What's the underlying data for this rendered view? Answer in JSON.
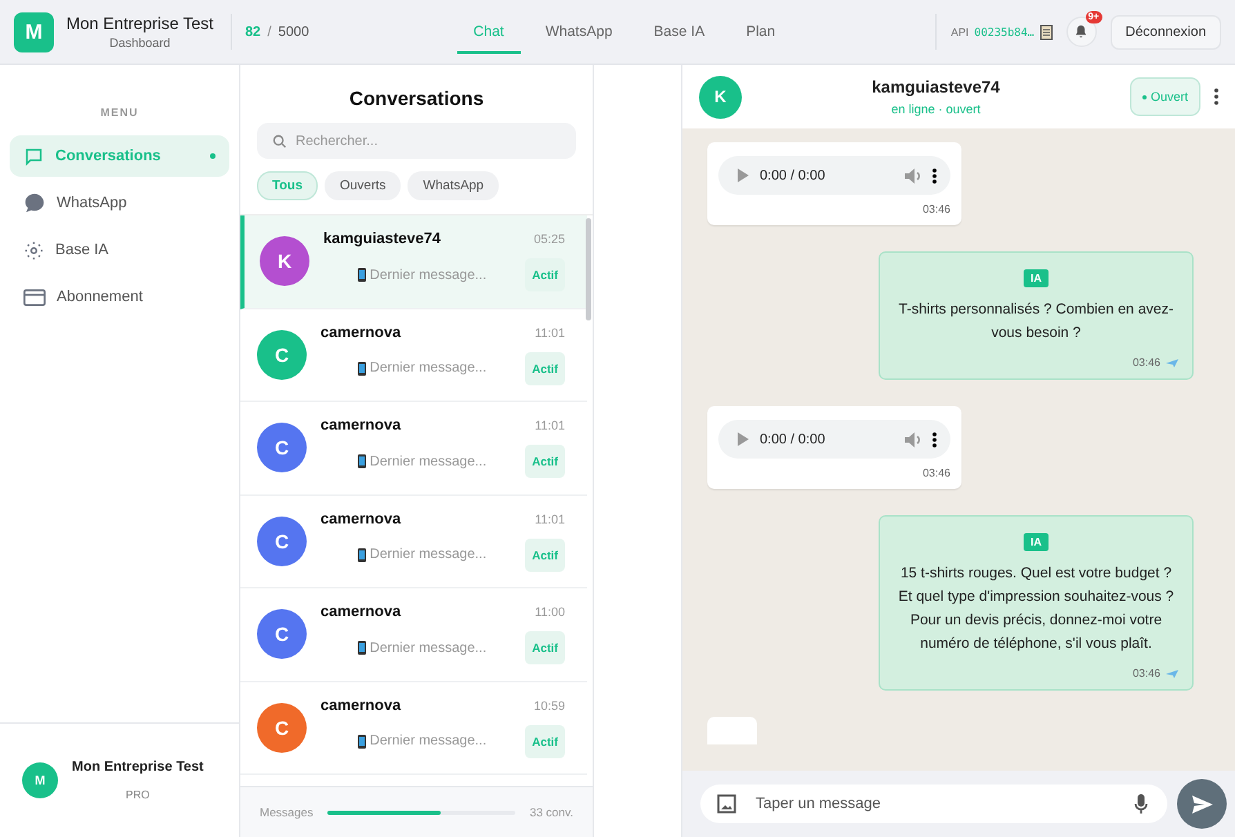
{
  "header": {
    "logo_letter": "M",
    "company": "Mon Entreprise Test",
    "subtitle": "Dashboard",
    "usage_count": "82",
    "usage_separator": "/",
    "usage_limit": "5000",
    "tabs": [
      {
        "label": "Chat",
        "selected": true
      },
      {
        "label": "WhatsApp",
        "selected": false
      },
      {
        "label": "Base IA",
        "selected": false
      },
      {
        "label": "Plan",
        "selected": false
      }
    ],
    "api_label": "API",
    "api_key": "00235b84…",
    "notification_badge": "9+",
    "logout": "Déconnexion"
  },
  "sidebar": {
    "heading": "MENU",
    "items": [
      {
        "label": "Conversations",
        "kind": "chat",
        "selected": true
      },
      {
        "label": "WhatsApp",
        "kind": "messaging",
        "selected": false
      },
      {
        "label": "Base IA",
        "kind": "knowledge",
        "selected": false
      },
      {
        "label": "Abonnement",
        "kind": "billing",
        "selected": false
      }
    ],
    "account": {
      "letter": "M",
      "name": "Mon Entreprise Test",
      "plan": "PRO"
    }
  },
  "conversations": {
    "title": "Conversations",
    "search": {
      "placeholder": "Rechercher..."
    },
    "filters": [
      {
        "label": "Tous",
        "selected": true
      },
      {
        "label": "Ouverts",
        "selected": false
      },
      {
        "label": "WhatsApp",
        "selected": false
      }
    ],
    "items": [
      {
        "letter": "K",
        "name": "kamguiasteve74",
        "time": "05:25",
        "preview": "Dernier message...",
        "status": "Actif",
        "color": "#b44fd0",
        "selected": true
      },
      {
        "letter": "C",
        "name": "camernova",
        "time": "11:01",
        "preview": "Dernier message...",
        "status": "Actif",
        "color": "#19c08a",
        "selected": false
      },
      {
        "letter": "C",
        "name": "camernova",
        "time": "11:01",
        "preview": "Dernier message...",
        "status": "Actif",
        "color": "#5575f0",
        "selected": false
      },
      {
        "letter": "C",
        "name": "camernova",
        "time": "11:01",
        "preview": "Dernier message...",
        "status": "Actif",
        "color": "#5575f0",
        "selected": false
      },
      {
        "letter": "C",
        "name": "camernova",
        "time": "11:00",
        "preview": "Dernier message...",
        "status": "Actif",
        "color": "#5575f0",
        "selected": false
      },
      {
        "letter": "C",
        "name": "camernova",
        "time": "10:59",
        "preview": "Dernier message...",
        "status": "Actif",
        "color": "#f06a2a",
        "selected": false
      }
    ],
    "footer": {
      "label": "Messages",
      "level": 0.6,
      "count": "33 conv."
    }
  },
  "chat": {
    "contact": {
      "letter": "K",
      "name": "kamguiasteve74",
      "status": "en ligne · ouvert"
    },
    "state_button": "Ouvert",
    "messages": [
      {
        "kind": "audio",
        "player": "0:00 / 0:00",
        "time": "03:46"
      },
      {
        "kind": "ai",
        "tag": "IA",
        "text": "T-shirts personnalisés ? Combien en avez-vous besoin ?",
        "time": "03:46"
      },
      {
        "kind": "audio",
        "player": "0:00 / 0:00",
        "time": "03:46"
      },
      {
        "kind": "ai",
        "tag": "IA",
        "text": "15 t-shirts rouges. Quel est votre budget ? Et quel type d'impression souhaitez-vous ? Pour un devis précis, donnez-moi votre numéro de téléphone, s'il vous plaît.",
        "time": "03:46"
      },
      {
        "kind": "partial"
      }
    ],
    "composer": {
      "placeholder": "Taper un message"
    }
  }
}
